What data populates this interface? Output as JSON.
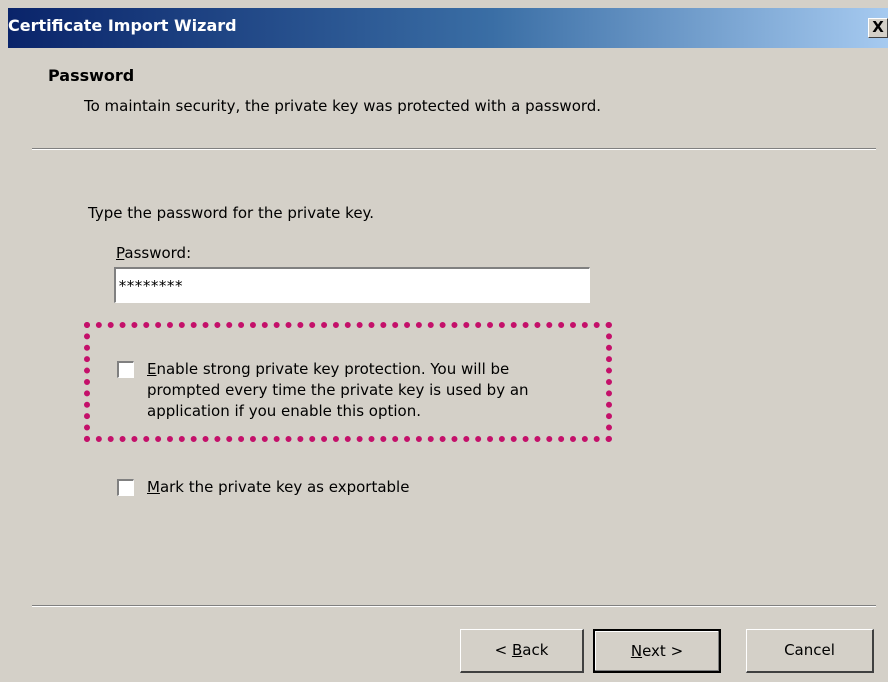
{
  "window": {
    "title": "Certificate Import Wizard",
    "close_label": "X"
  },
  "header": {
    "title": "Password",
    "description": "To maintain security, the private key was protected with a password."
  },
  "content": {
    "instruction": "Type the password for the private key.",
    "password_label_mnemonic": "P",
    "password_label_rest": "assword:",
    "password_value": "********",
    "strong_protection": {
      "checked": false,
      "mnemonic": "E",
      "line1_rest": "nable strong private key protection. You will be",
      "line2": "prompted every time the private key is used by an",
      "line3": "application if you enable this option."
    },
    "exportable": {
      "checked": false,
      "mnemonic": "M",
      "rest": "ark the private key as exportable"
    }
  },
  "buttons": {
    "back_prefix": "< ",
    "back_mnemonic": "B",
    "back_rest": "ack",
    "next_mnemonic": "N",
    "next_rest": "ext >",
    "cancel": "Cancel"
  },
  "colors": {
    "title_gradient_start": "#0a246a",
    "title_gradient_end": "#a6caf0",
    "dialog_bg": "#d4d0c8",
    "highlight_border": "#c4106a"
  }
}
